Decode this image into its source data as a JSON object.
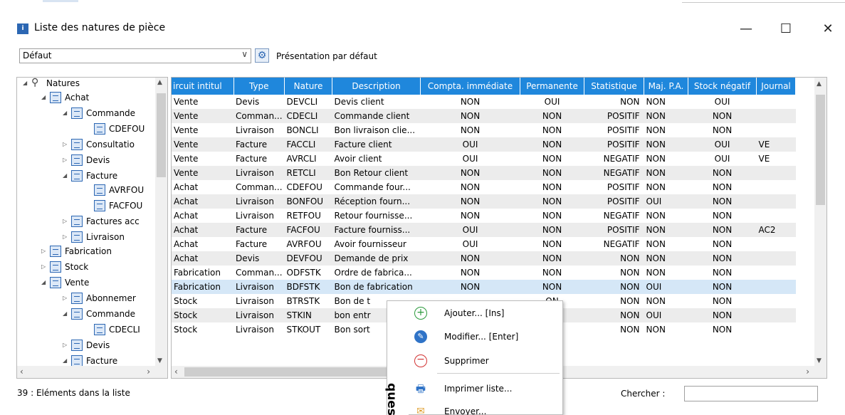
{
  "window": {
    "title": "Liste des natures de pièce",
    "minimize": "—",
    "maximize": "☐",
    "close": "✕"
  },
  "toolbar": {
    "presentation_combo": "Défaut",
    "combo_arrow": "∨",
    "presentation_label": "Présentation par défaut"
  },
  "tree": {
    "items": [
      {
        "label": "Natures",
        "expander": "◢",
        "icon": "search-icon"
      },
      {
        "label": "Achat",
        "expander": "◢",
        "icon": "folder-doc-icon"
      },
      {
        "label": "Commande",
        "expander": "◢",
        "icon": "folder-doc-icon"
      },
      {
        "label": "CDEFOU",
        "expander": "",
        "icon": "doc-icon"
      },
      {
        "label": "Consultatio",
        "expander": "▷",
        "icon": "folder-doc-icon"
      },
      {
        "label": "Devis",
        "expander": "▷",
        "icon": "folder-doc-icon"
      },
      {
        "label": "Facture",
        "expander": "◢",
        "icon": "folder-doc-icon"
      },
      {
        "label": "AVRFOU",
        "expander": "",
        "icon": "doc-icon"
      },
      {
        "label": "FACFOU",
        "expander": "",
        "icon": "doc-icon"
      },
      {
        "label": "Factures acc",
        "expander": "▷",
        "icon": "folder-doc-icon"
      },
      {
        "label": "Livraison",
        "expander": "▷",
        "icon": "folder-doc-icon"
      },
      {
        "label": "Fabrication",
        "expander": "▷",
        "icon": "folder-doc-icon"
      },
      {
        "label": "Stock",
        "expander": "▷",
        "icon": "folder-doc-icon"
      },
      {
        "label": "Vente",
        "expander": "◢",
        "icon": "folder-doc-icon"
      },
      {
        "label": "Abonnemer",
        "expander": "▷",
        "icon": "folder-doc-icon"
      },
      {
        "label": "Commande",
        "expander": "◢",
        "icon": "folder-doc-icon"
      },
      {
        "label": "CDECLI",
        "expander": "",
        "icon": "doc-icon"
      },
      {
        "label": "Devis",
        "expander": "▷",
        "icon": "folder-doc-icon"
      },
      {
        "label": "Facture",
        "expander": "◢",
        "icon": "folder-doc-icon"
      }
    ]
  },
  "grid": {
    "columns": [
      "ircuit intitul",
      "Type",
      "Nature",
      "Description",
      "Compta. immédiate",
      "Permanente",
      "Statistique",
      "Maj. P.A.",
      "Stock négatif",
      "Journal"
    ],
    "rows": [
      [
        "Vente",
        "Devis",
        "DEVCLI",
        "Devis client",
        "NON",
        "OUI",
        "NON",
        "NON",
        "OUI",
        ""
      ],
      [
        "Vente",
        "Comman...",
        "CDECLI",
        "Commande client",
        "NON",
        "NON",
        "POSITIF",
        "NON",
        "NON",
        ""
      ],
      [
        "Vente",
        "Livraison",
        "BONCLI",
        "Bon livraison clie...",
        "NON",
        "NON",
        "POSITIF",
        "NON",
        "NON",
        ""
      ],
      [
        "Vente",
        "Facture",
        "FACCLI",
        "Facture client",
        "OUI",
        "NON",
        "POSITIF",
        "NON",
        "OUI",
        "VE"
      ],
      [
        "Vente",
        "Facture",
        "AVRCLI",
        "Avoir client",
        "OUI",
        "NON",
        "NEGATIF",
        "NON",
        "OUI",
        "VE"
      ],
      [
        "Vente",
        "Livraison",
        "RETCLI",
        "Bon Retour client",
        "NON",
        "NON",
        "NEGATIF",
        "NON",
        "NON",
        ""
      ],
      [
        "Achat",
        "Comman...",
        "CDEFOU",
        "Commande four...",
        "NON",
        "NON",
        "POSITIF",
        "NON",
        "NON",
        ""
      ],
      [
        "Achat",
        "Livraison",
        "BONFOU",
        "Réception fourn...",
        "NON",
        "NON",
        "POSITIF",
        "OUI",
        "NON",
        ""
      ],
      [
        "Achat",
        "Livraison",
        "RETFOU",
        "Retour fournisse...",
        "NON",
        "NON",
        "NEGATIF",
        "NON",
        "NON",
        ""
      ],
      [
        "Achat",
        "Facture",
        "FACFOU",
        "Facture fourniss...",
        "OUI",
        "NON",
        "POSITIF",
        "NON",
        "NON",
        "AC2"
      ],
      [
        "Achat",
        "Facture",
        "AVRFOU",
        "Avoir fournisseur",
        "OUI",
        "NON",
        "NEGATIF",
        "NON",
        "NON",
        ""
      ],
      [
        "Achat",
        "Devis",
        "DEVFOU",
        "Demande de prix",
        "NON",
        "NON",
        "NON",
        "NON",
        "NON",
        ""
      ],
      [
        "Fabrication",
        "Comman...",
        "ODFSTK",
        "Ordre de fabrica...",
        "NON",
        "NON",
        "NON",
        "NON",
        "NON",
        ""
      ],
      [
        "Fabrication",
        "Livraison",
        "BDFSTK",
        "Bon de fabrication",
        "NON",
        "NON",
        "NON",
        "OUI",
        "NON",
        ""
      ],
      [
        "Stock",
        "Livraison",
        "BTRSTK",
        "Bon de t",
        "",
        "ON",
        "NON",
        "NON",
        "NON",
        ""
      ],
      [
        "Stock",
        "Livraison",
        "STKIN",
        "bon entr",
        "",
        "ON",
        "NON",
        "OUI",
        "NON",
        ""
      ],
      [
        "Stock",
        "Livraison",
        "STKOUT",
        "Bon sort",
        "",
        "ON",
        "NON",
        "NON",
        "NON",
        ""
      ]
    ],
    "selected_row": 13
  },
  "status": {
    "count_text": "39 : Eléments dans la liste",
    "search_label": "Chercher :",
    "search_value": ""
  },
  "context_menu": {
    "side_text": "ques",
    "items": [
      {
        "label": "Ajouter... [Ins]",
        "icon": "add-icon",
        "glyph": "+"
      },
      {
        "label": "Modifier... [Enter]",
        "icon": "edit-icon",
        "glyph": "✎"
      },
      {
        "label": "Supprimer",
        "icon": "delete-icon",
        "glyph": "−"
      },
      {
        "label": "Imprimer liste...",
        "icon": "print-icon",
        "glyph": "🖶"
      },
      {
        "label": "Envoyer...",
        "icon": "mail-icon",
        "glyph": "✉"
      }
    ]
  },
  "colors": {
    "header_blue": "#1f87dc",
    "selected_row": "#d5e7f7",
    "alt_row": "#ececec"
  }
}
